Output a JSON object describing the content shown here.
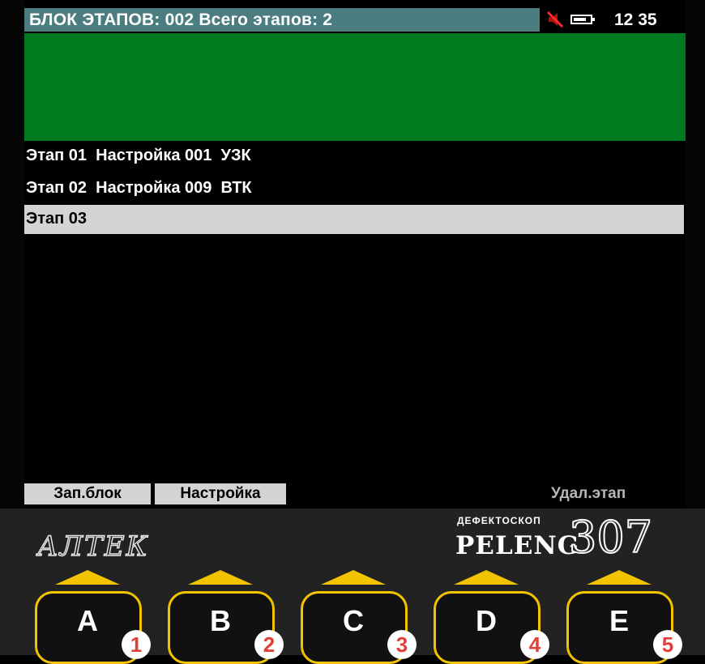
{
  "header": {
    "title": "БЛОК ЭТАПОВ: 002 Всего этапов: 2",
    "clock": "12 35",
    "icons": [
      "mute-icon",
      "battery-icon"
    ],
    "colors": {
      "title_bg": "#4a7c80",
      "plot_bg": "#007a1e",
      "selected_bg": "#d4d4d4"
    }
  },
  "stages": [
    {
      "label": "Этап 01  Настройка 001  УЗК",
      "selected": false
    },
    {
      "label": "Этап 02  Настройка 009  ВТК",
      "selected": false
    },
    {
      "label": "Этап 03",
      "selected": true
    }
  ],
  "softkeys": {
    "save_block": "Зап.блок",
    "settings": "Настройка",
    "delete_stage": "Удал.этап"
  },
  "device": {
    "logo": "АЛТЕК",
    "subtitle": "ДЕФЕКТОСКОП",
    "brand": "PELENG",
    "model": "307"
  },
  "hardware_keys": [
    {
      "letter": "A",
      "number": "1"
    },
    {
      "letter": "B",
      "number": "2"
    },
    {
      "letter": "C",
      "number": "3"
    },
    {
      "letter": "D",
      "number": "4"
    },
    {
      "letter": "E",
      "number": "5"
    }
  ]
}
